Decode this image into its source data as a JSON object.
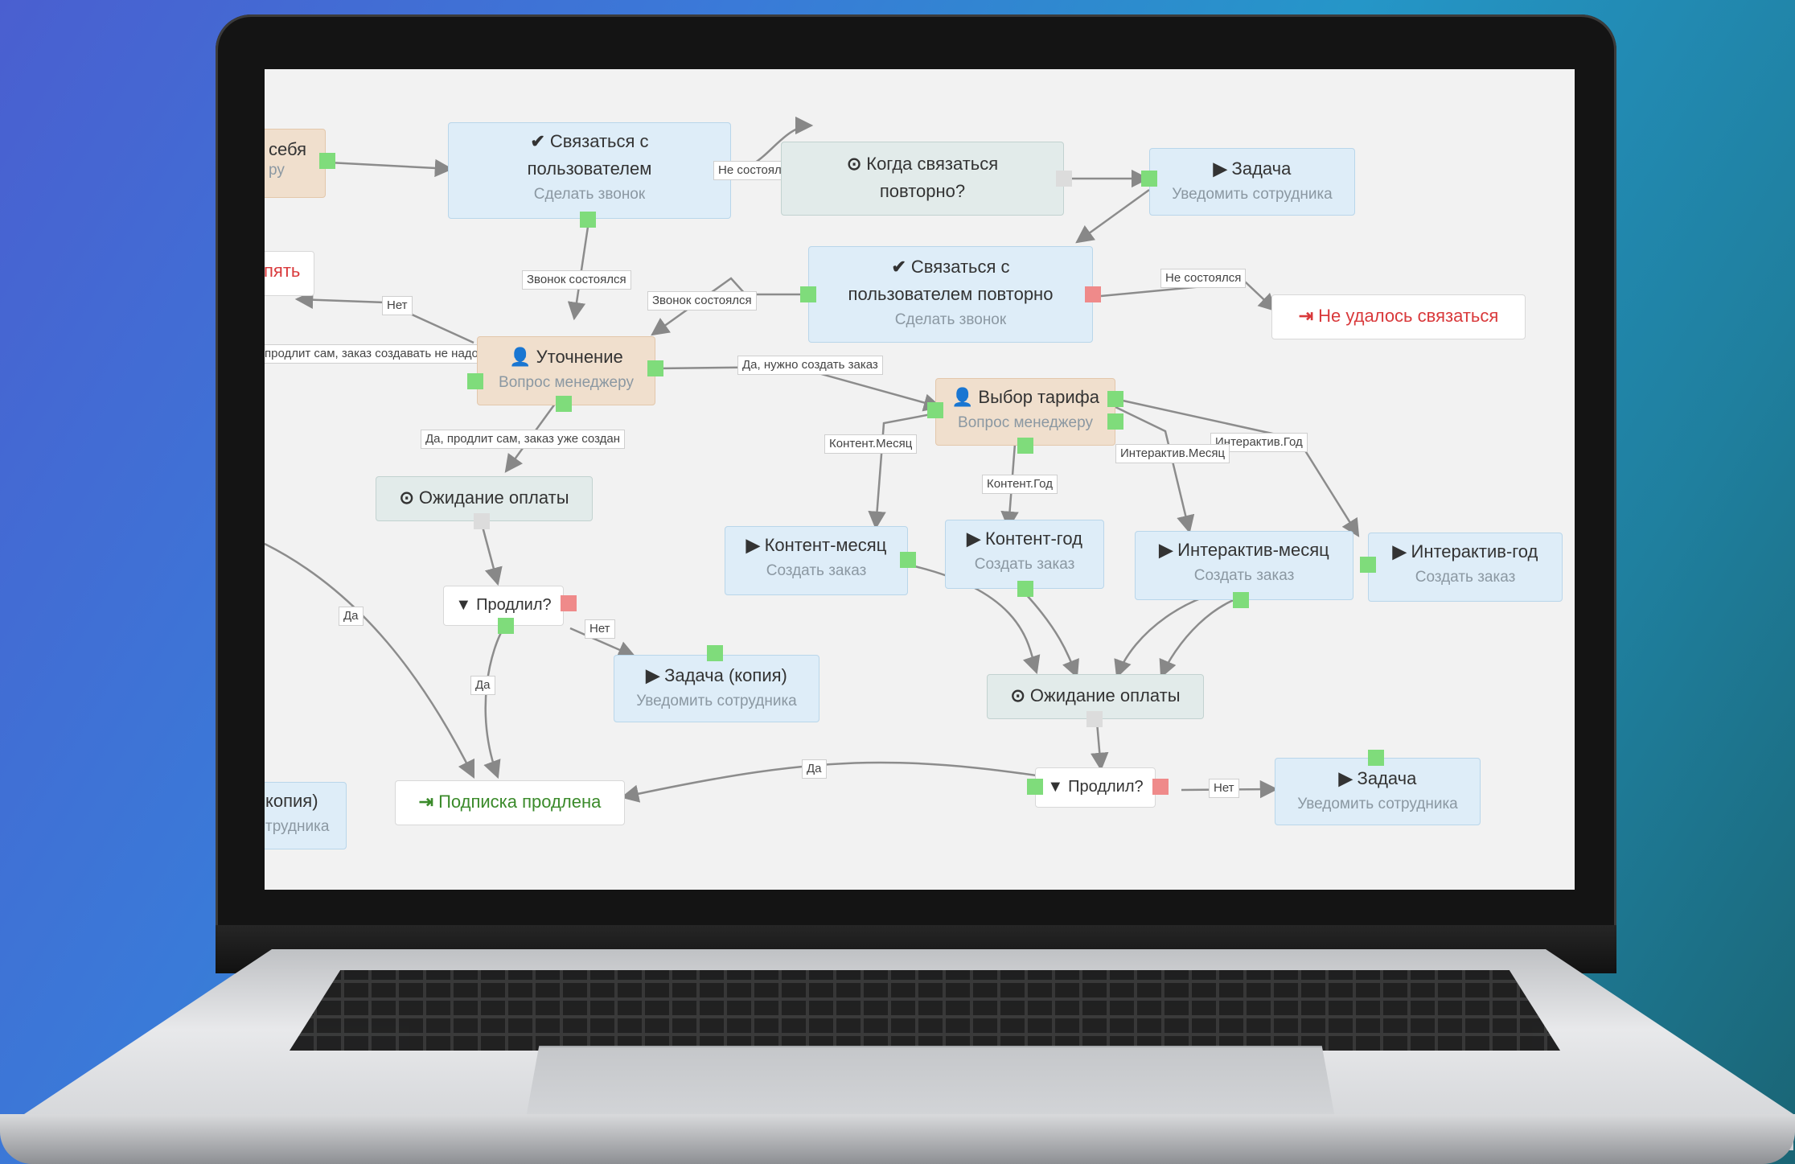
{
  "nodes": {
    "sebya": {
      "line1": "себя",
      "line2": "ру"
    },
    "svyazatsya": {
      "icon": "✔",
      "line1": "Связаться с",
      "line2": "пользователем",
      "sub": "Сделать звонок"
    },
    "kogda": {
      "icon": "⊙",
      "line1": "Когда связаться",
      "line2": "повторно?"
    },
    "zadacha1": {
      "icon": "▶",
      "title": "Задача",
      "sub": "Уведомить сотрудника"
    },
    "pyat": {
      "text": "пять"
    },
    "svyazatsya2": {
      "icon": "✔",
      "line1": "Связаться с",
      "line2": "пользователем повторно",
      "sub": "Сделать звонок"
    },
    "ne_udalos": {
      "icon": "⇥",
      "text": "Не удалось связаться"
    },
    "utochnenie": {
      "icon": "👤",
      "title": "Уточнение",
      "sub": "Вопрос менеджеру"
    },
    "vybor": {
      "icon": "👤",
      "title": "Выбор тарифа",
      "sub": "Вопрос менеджеру"
    },
    "ozhidanie1": {
      "icon": "⊙",
      "text": "Ожидание оплаты"
    },
    "kontent_mesyac": {
      "icon": "▶",
      "title": "Контент-месяц",
      "sub": "Создать заказ"
    },
    "kontent_god": {
      "icon": "▶",
      "title": "Контент-год",
      "sub": "Создать заказ"
    },
    "interaktiv_mesyac": {
      "icon": "▶",
      "title": "Интерактив-месяц",
      "sub": "Создать заказ"
    },
    "interaktiv_god": {
      "icon": "▶",
      "title": "Интерактив-год",
      "sub": "Создать заказ"
    },
    "prodlil1": {
      "icon": "▼",
      "text": "Продлил?"
    },
    "zadacha_kopiya": {
      "icon": "▶",
      "title": "Задача (копия)",
      "sub": "Уведомить сотрудника"
    },
    "ozhidanie2": {
      "icon": "⊙",
      "text": "Ожидание оплаты"
    },
    "kopiya_left": {
      "line1": "копия)",
      "line2": "трудника"
    },
    "podpiska": {
      "icon": "⇥",
      "text": "Подписка продлена"
    },
    "prodlil2": {
      "icon": "▼",
      "text": "Продлил?"
    },
    "zadacha2": {
      "icon": "▶",
      "title": "Задача",
      "sub": "Уведомить сотрудника"
    }
  },
  "labels": {
    "ne_sostoyalsya1": "Не состоялся",
    "zvonok1": "Звонок состоялся",
    "zvonok2": "Звонок состоялся",
    "ne_sostoyalsya2": "Не состоялся",
    "net1": "Нет",
    "prodlit_sam": "продлит сам, заказ создавать не надо",
    "da_nuzhno": "Да, нужно создать заказ",
    "da_prodlit": "Да, продлит сам, заказ уже создан",
    "kontent_mesyac": "Контент.Месяц",
    "kontent_god": "Контент.Год",
    "interaktiv_mesyac": "Интерактив.Месяц",
    "interaktiv_god": "Интерактив.Год",
    "da1": "Да",
    "net2": "Нет",
    "da2": "Да",
    "da3": "Да",
    "net3": "Нет"
  },
  "colors": {
    "port_ok": "#7fdc7b",
    "port_fail": "#ef8a8a",
    "node_task": "#deedf8",
    "node_question": "#f0dfcd",
    "node_wait": "#e2ebea"
  }
}
